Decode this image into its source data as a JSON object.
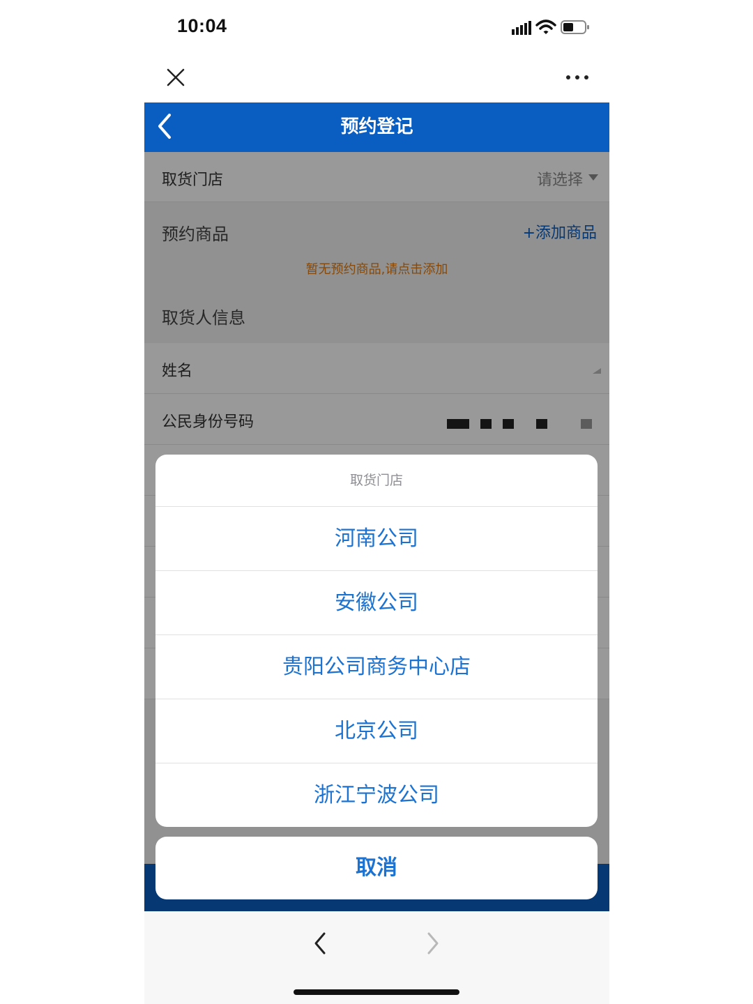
{
  "status": {
    "time": "10:04"
  },
  "nav": {
    "title": "预约登记"
  },
  "form": {
    "store_label": "取货门店",
    "store_value": "请选择",
    "goods_label": "预约商品",
    "add_goods": "+添加商品",
    "empty_hint": "暂无预约商品,请点击添加",
    "pickup_info_label": "取货人信息",
    "name_label": "姓名",
    "id_label": "公民身份号码"
  },
  "sheet": {
    "title": "取货门店",
    "options": [
      "河南公司",
      "安徽公司",
      "贵阳公司商务中心店",
      "北京公司",
      "浙江宁波公司"
    ],
    "cancel": "取消"
  },
  "colors": {
    "brand_blue": "#0b5ec1",
    "option_blue": "#1b72d0",
    "hint_orange": "#e07a10"
  }
}
